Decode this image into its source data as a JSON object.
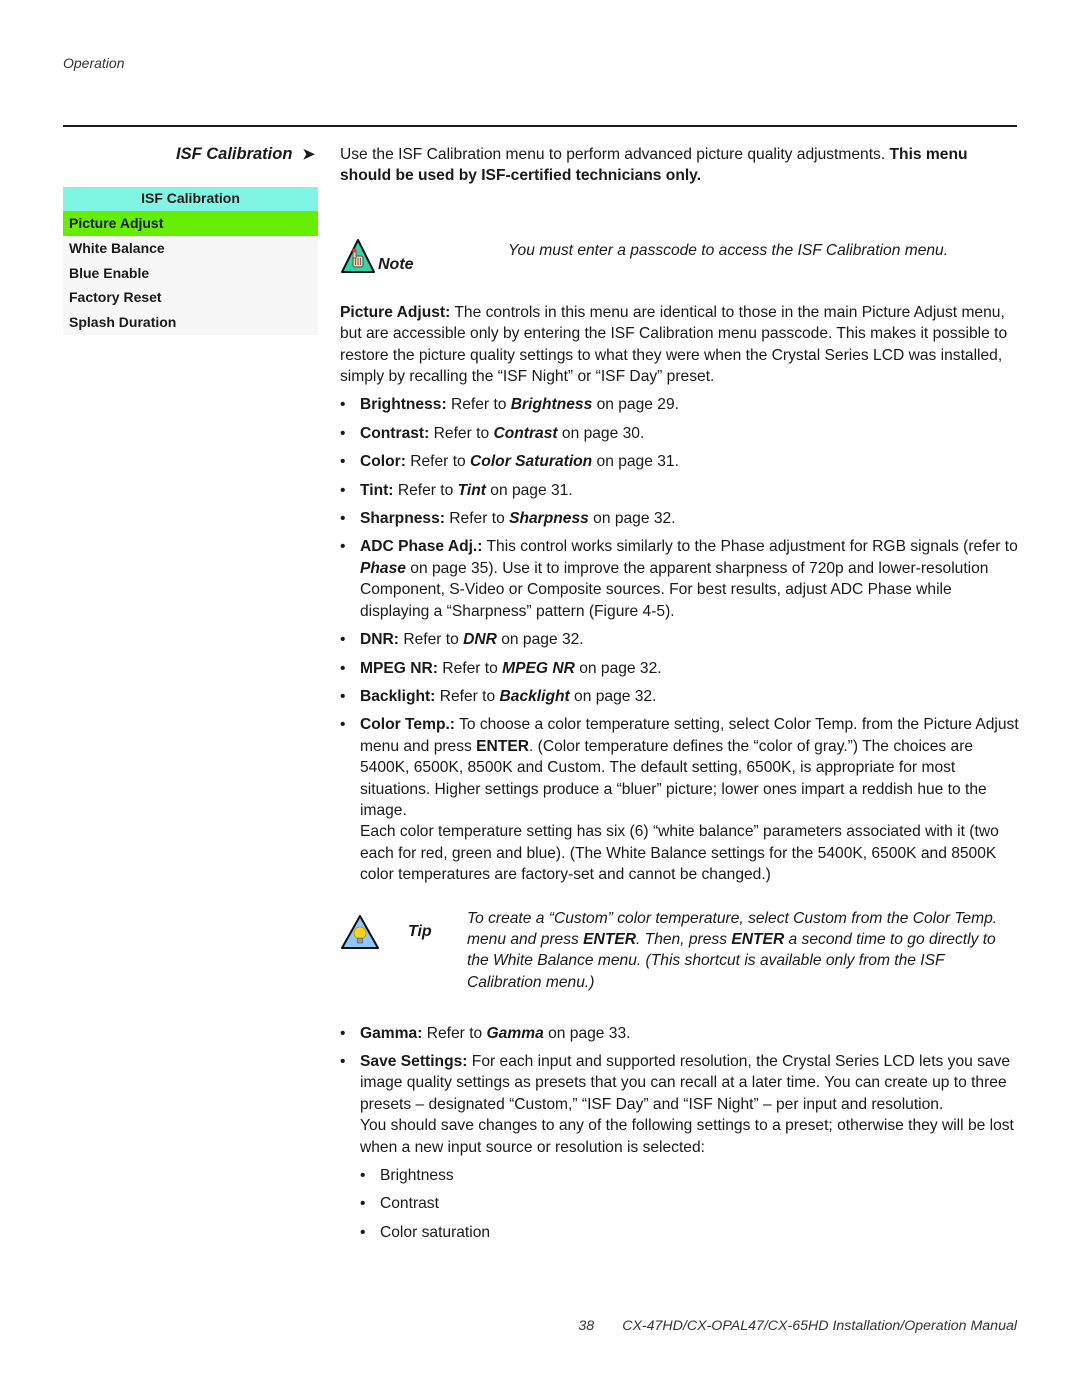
{
  "running_head": "Operation",
  "section_heading": "ISF Calibration",
  "section_arrow": "➤",
  "menu": {
    "title": "ISF Calibration",
    "items": [
      {
        "label": "Picture Adjust",
        "selected": true
      },
      {
        "label": "White Balance",
        "selected": false
      },
      {
        "label": "Blue Enable",
        "selected": false
      },
      {
        "label": "Factory Reset",
        "selected": false
      },
      {
        "label": "Splash Duration",
        "selected": false
      }
    ],
    "colors": {
      "title_bg": "#7ff5e4",
      "selected_bg": "#66ee00",
      "menu_bg": "#f7f7f7"
    }
  },
  "intro": {
    "text": "Use the ISF Calibration menu to perform advanced picture quality adjustments. ",
    "bold": "This menu should be used by ISF-certified technicians only."
  },
  "note": {
    "icon": "note-hand-icon",
    "label": "Note",
    "text": "You must enter a passcode to access the ISF Calibration menu."
  },
  "picture_adjust": {
    "lead": "Picture Adjust:",
    "text": " The controls in this menu are identical to those in the main Picture Adjust menu, but are accessible only by entering the ISF Calibration menu passcode. This makes it possible to restore the picture quality settings to what they were when the Crystal Series LCD was installed, simply by recalling the “ISF Night” or “ISF Day” preset."
  },
  "bullets": [
    {
      "lead": "Brightness:",
      "pre": " Refer to ",
      "ref": "Brightness",
      "post": " on page 29."
    },
    {
      "lead": "Contrast:",
      "pre": " Refer to ",
      "ref": "Contrast",
      "post": " on page 30."
    },
    {
      "lead": "Color:",
      "pre": " Refer to ",
      "ref": "Color Saturation",
      "post": " on page 31."
    },
    {
      "lead": "Tint:",
      "pre": " Refer to ",
      "ref": "Tint",
      "post": " on page 31."
    },
    {
      "lead": "Sharpness:",
      "pre": " Refer to ",
      "ref": "Sharpness",
      "post": " on page 32."
    },
    {
      "lead": "ADC Phase Adj.:",
      "pre": " This control works similarly to the Phase adjustment for RGB signals (refer to ",
      "ref": "Phase",
      "post": " on page 35). Use it to improve the apparent sharpness of 720p and lower-resolution Component, S-Video or Composite sources. For best results, adjust ADC Phase while displaying a “Sharpness” pattern (Figure 4-5)."
    },
    {
      "lead": "DNR:",
      "pre": " Refer to ",
      "ref": "DNR",
      "post": " on page 32."
    },
    {
      "lead": "MPEG NR:",
      "pre": " Refer to ",
      "ref": "MPEG NR",
      "post": " on page 32."
    },
    {
      "lead": "Backlight:",
      "pre": " Refer to ",
      "ref": "Backlight",
      "post": " on page 32."
    }
  ],
  "color_temp": {
    "lead": "Color Temp.:",
    "text1": " To choose a color temperature setting, select Color Temp. from the Picture Adjust menu and press ",
    "enter": "ENTER",
    "text2": ". (Color temperature defines the “color of gray.”) The choices are 5400K, 6500K, 8500K and Custom. The default setting, 6500K, is appropriate for most situations. Higher settings produce a “bluer” picture; lower ones impart a reddish hue to the image.",
    "para2": "Each color temperature setting has six (6) “white balance” parameters associated with it (two each for red, green and blue). (The White Balance settings for the 5400K, 6500K and 8500K color temperatures are factory-set and cannot be changed.)"
  },
  "tip": {
    "icon": "tip-lightbulb-icon",
    "label": "Tip",
    "t1": "To create a “Custom” color temperature, select Custom from the Color Temp. menu and press ",
    "enter1": "ENTER",
    "t2": ". Then, press ",
    "enter2": "ENTER",
    "t3": " a second time to go directly to the White Balance menu. (This shortcut is available only from the ISF Calibration menu.)"
  },
  "gamma": {
    "lead": "Gamma:",
    "pre": " Refer to ",
    "ref": "Gamma",
    "post": " on page 33."
  },
  "save_settings": {
    "lead": "Save Settings:",
    "text": " For each input and supported resolution, the Crystal Series LCD lets you save image quality settings as presets that you can recall at a later time. You can create up to three presets – designated “Custom,” “ISF Day” and “ISF Night” – per input and resolution.",
    "para2": "You should save changes to any of the following settings to a preset; otherwise they will be lost when a new input source or resolution is selected:",
    "list": [
      "Brightness",
      "Contrast",
      "Color saturation"
    ]
  },
  "footer": {
    "page_number": "38",
    "manual_title": "CX-47HD/CX-OPAL47/CX-65HD Installation/Operation Manual"
  }
}
